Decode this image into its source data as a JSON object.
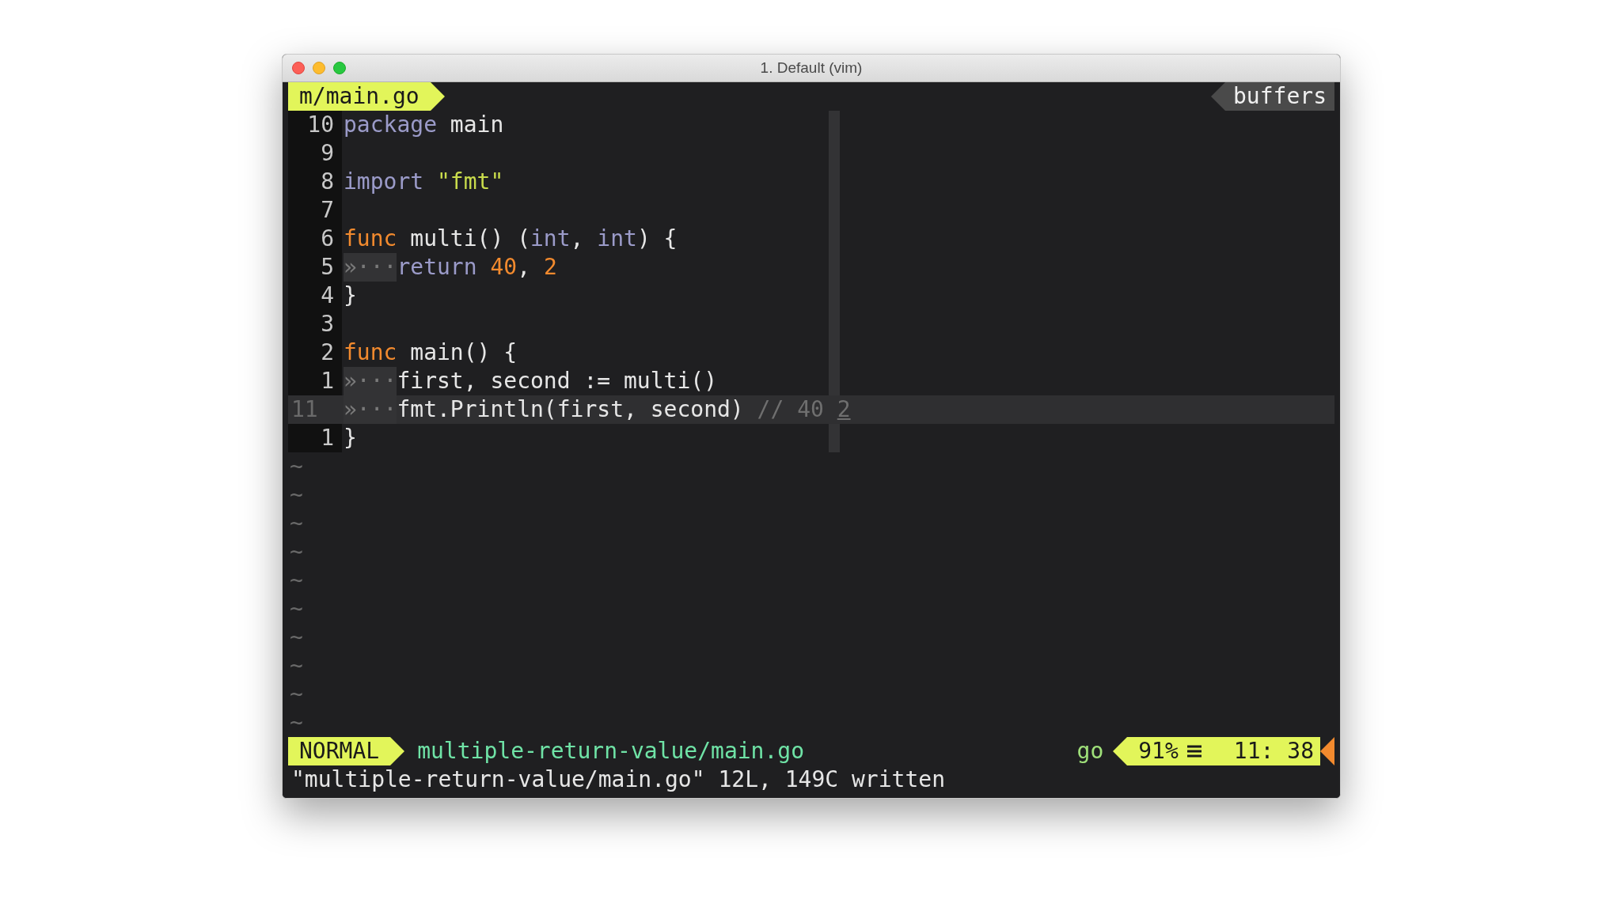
{
  "window": {
    "title": "1. Default (vim)"
  },
  "tabline": {
    "tab": "m/main.go",
    "right": "buffers"
  },
  "lines": [
    {
      "number": "10",
      "current": false,
      "tokens": [
        {
          "text": "package",
          "kind": "keyword"
        },
        {
          "text": " main",
          "kind": "plain"
        }
      ]
    },
    {
      "number": "9",
      "current": false
    },
    {
      "number": "8",
      "current": false,
      "tokens": [
        {
          "text": "import",
          "kind": "keyword"
        },
        {
          "text": " \"fmt\"",
          "kind": "string"
        }
      ]
    },
    {
      "number": "7",
      "current": false
    },
    {
      "number": "6",
      "current": false,
      "tokens": [
        {
          "text": "func",
          "kind": "func"
        },
        {
          "text": " multi() (",
          "kind": "plain"
        },
        {
          "text": "int",
          "kind": "keyword"
        },
        {
          "text": ", ",
          "kind": "plain"
        },
        {
          "text": "int",
          "kind": "keyword"
        },
        {
          "text": ") {",
          "kind": "plain"
        }
      ]
    },
    {
      "number": "5",
      "current": false,
      "tokens": [
        {
          "text": "»···",
          "kind": "indent"
        },
        {
          "text": "return",
          "kind": "keyword"
        },
        {
          "text": " 40",
          "kind": "number"
        },
        {
          "text": ", ",
          "kind": "plain"
        },
        {
          "text": "2",
          "kind": "number"
        }
      ]
    },
    {
      "number": "4",
      "current": false,
      "tokens": [
        {
          "text": "}",
          "kind": "plain"
        }
      ]
    },
    {
      "number": "3",
      "current": false
    },
    {
      "number": "2",
      "current": false,
      "tokens": [
        {
          "text": "func",
          "kind": "func"
        },
        {
          "text": " main() {",
          "kind": "plain"
        }
      ]
    },
    {
      "number": "1",
      "current": false,
      "tokens": [
        {
          "text": "»···",
          "kind": "indent"
        },
        {
          "text": "first, second := multi()",
          "kind": "plain"
        }
      ]
    },
    {
      "number": "11",
      "current": true,
      "tokens": [
        {
          "text": "»···",
          "kind": "indent"
        },
        {
          "text": "fmt.Println(first, second)",
          "kind": "plain"
        },
        {
          "text": " // 40 ",
          "kind": "comment"
        },
        {
          "text": "2",
          "kind": "cursor"
        }
      ]
    },
    {
      "number": "1",
      "current": false,
      "tokens": [
        {
          "text": "}",
          "kind": "plain"
        }
      ]
    }
  ],
  "empty_lines": [
    "~",
    "~",
    "~",
    "~",
    "~",
    "~",
    "~",
    "~",
    "~",
    "~"
  ],
  "status_bar": {
    "mode": "NORMAL",
    "file": "multiple-return-value/main.go",
    "filetype": "go",
    "percent": "91%",
    "position": "11: 38"
  },
  "command_line": "\"multiple-return-value/main.go\" 12L, 149C written"
}
